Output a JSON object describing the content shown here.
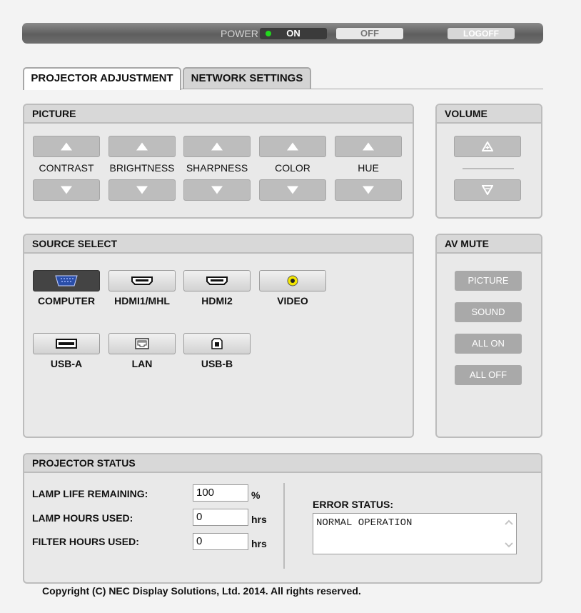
{
  "power": {
    "label": "POWER",
    "on": "ON",
    "off": "OFF",
    "logoff": "LOGOFF"
  },
  "tabs": {
    "projector_adjustment": "PROJECTOR ADJUSTMENT",
    "network_settings": "NETWORK SETTINGS"
  },
  "picture": {
    "title": "PICTURE",
    "controls": [
      "CONTRAST",
      "BRIGHTNESS",
      "SHARPNESS",
      "COLOR",
      "HUE"
    ]
  },
  "volume": {
    "title": "VOLUME"
  },
  "source": {
    "title": "SOURCE SELECT",
    "items": [
      "COMPUTER",
      "HDMI1/MHL",
      "HDMI2",
      "VIDEO",
      "USB-A",
      "LAN",
      "USB-B"
    ],
    "selected": "COMPUTER"
  },
  "av_mute": {
    "title": "AV MUTE",
    "buttons": [
      "PICTURE",
      "SOUND",
      "ALL ON",
      "ALL OFF"
    ]
  },
  "status": {
    "title": "PROJECTOR STATUS",
    "lamp_life_label": "LAMP LIFE REMAINING:",
    "lamp_life_value": "100",
    "lamp_life_unit": "%",
    "lamp_hours_label": "LAMP HOURS USED:",
    "lamp_hours_value": "0",
    "lamp_hours_unit": "hrs",
    "filter_hours_label": "FILTER HOURS USED:",
    "filter_hours_value": "0",
    "filter_hours_unit": "hrs",
    "error_label": "ERROR STATUS:",
    "error_value": "NORMAL OPERATION"
  },
  "footer": {
    "copyright": "Copyright (C) NEC Display Solutions, Ltd. 2014. All rights reserved."
  }
}
